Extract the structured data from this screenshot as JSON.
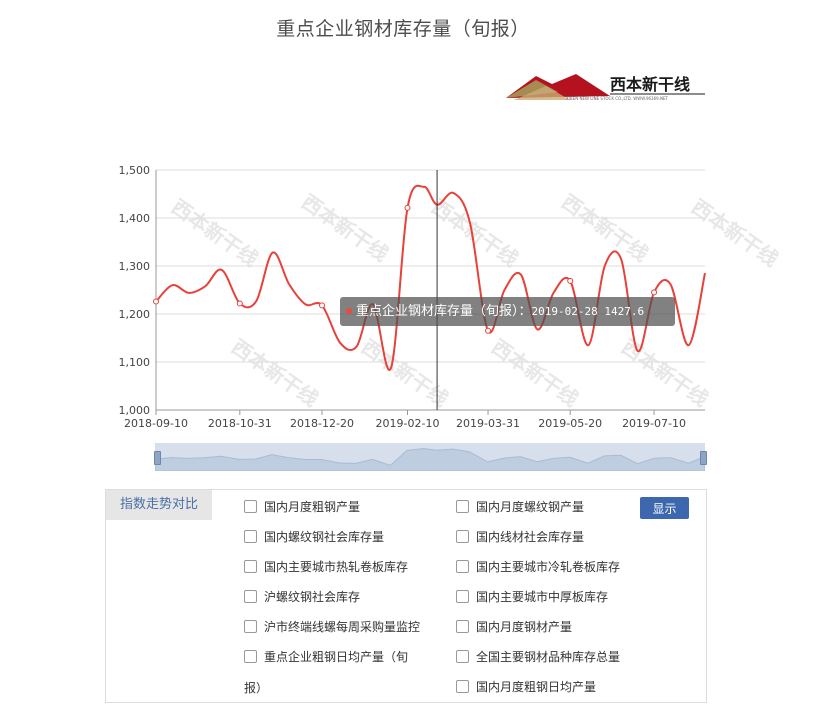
{
  "page": {
    "title": "重点企业钢材库存量（旬报）"
  },
  "logo": {
    "brand": "西本新干线",
    "subtitle": "XIBEN NEW LINE STOCK CO.,LTD.   WWW.96369.NET"
  },
  "watermark": "西本新干线",
  "tooltip": {
    "series": "重点企业钢材库存量（旬报）：",
    "value": "2019-02-28 1427.6"
  },
  "colors": {
    "line": "#e8413a",
    "grid": "#dddddd",
    "axis": "#999999",
    "button": "#3d68b0"
  },
  "chart_data": {
    "type": "line",
    "title": "重点企业钢材库存量（旬报）",
    "xlabel": "",
    "ylabel": "",
    "ylim": [
      1000,
      1500
    ],
    "yticks": [
      "1,000",
      "1,100",
      "1,200",
      "1,300",
      "1,400",
      "1,500"
    ],
    "xticks": [
      "2018-09-10",
      "2018-10-31",
      "2018-12-20",
      "2019-02-10",
      "2019-03-31",
      "2019-05-20",
      "2019-07-10"
    ],
    "grid": true,
    "x": [
      "2018-09-10",
      "2018-09-20",
      "2018-09-30",
      "2018-10-10",
      "2018-10-20",
      "2018-10-31",
      "2018-11-10",
      "2018-11-20",
      "2018-11-30",
      "2018-12-10",
      "2018-12-20",
      "2018-12-31",
      "2019-01-10",
      "2019-01-20",
      "2019-01-31",
      "2019-02-10",
      "2019-02-20",
      "2019-02-28",
      "2019-03-10",
      "2019-03-20",
      "2019-03-31",
      "2019-04-10",
      "2019-04-20",
      "2019-04-30",
      "2019-05-10",
      "2019-05-20",
      "2019-05-31",
      "2019-06-10",
      "2019-06-20",
      "2019-06-30",
      "2019-07-10",
      "2019-07-20",
      "2019-07-31",
      "2019-08-10"
    ],
    "values": [
      1226,
      1260,
      1244,
      1258,
      1292,
      1222,
      1227,
      1328,
      1262,
      1220,
      1218,
      1140,
      1132,
      1220,
      1088,
      1421,
      1465,
      1427.6,
      1452,
      1390,
      1165,
      1250,
      1282,
      1168,
      1245,
      1269,
      1135,
      1300,
      1314,
      1123,
      1245,
      1262,
      1135,
      1285
    ],
    "marked_points": [
      "2018-09-10",
      "2018-10-31",
      "2018-12-20",
      "2019-02-10",
      "2019-03-31",
      "2019-05-20",
      "2019-07-10"
    ],
    "highlight": "2019-02-28",
    "series": [
      {
        "name": "重点企业钢材库存量（旬报）"
      }
    ]
  },
  "compare": {
    "header": "指数走势对比",
    "button": "显示",
    "left": [
      "国内月度粗钢产量",
      "国内螺纹钢社会库存量",
      "国内主要城市热轧卷板库存",
      "沪螺纹钢社会库存",
      "沪市终端线螺每周采购量监控",
      "重点企业粗钢日均产量（旬"
    ],
    "left_wrap": "报）",
    "right": [
      "国内月度螺纹钢产量",
      "国内线材社会库存量",
      "国内主要城市冷轧卷板库存",
      "国内主要城市中厚板库存",
      "国内月度钢材产量",
      "全国主要钢材品种库存总量",
      "国内月度粗钢日均产量"
    ]
  }
}
